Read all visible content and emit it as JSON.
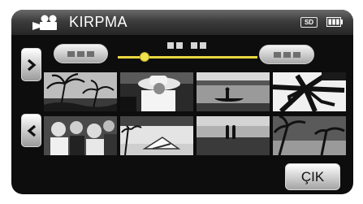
{
  "header": {
    "title": "KIRPMA",
    "mode_icon": "video-camera-icon",
    "media_badge": "SD",
    "battery_icon": "battery-full-icon"
  },
  "trim": {
    "start_marker_icon": "trim-start-marker-icon",
    "end_marker_icon": "trim-end-marker-icon",
    "timecode_icon": "timecode-blocks-icon",
    "position_fraction": 0.19,
    "accent_color": "#e8d640"
  },
  "navigation": {
    "next_icon": "chevron-right-icon",
    "prev_icon": "chevron-left-icon"
  },
  "thumbnails": [
    {
      "subject": "palm-trees"
    },
    {
      "subject": "person-in-hat"
    },
    {
      "subject": "canoe-on-water"
    },
    {
      "subject": "palm-fronds"
    },
    {
      "subject": "group-of-people"
    },
    {
      "subject": "beach-chair"
    },
    {
      "subject": "couple-at-sunset"
    },
    {
      "subject": "palm-silhouette"
    }
  ],
  "footer": {
    "exit_label": "ÇIK"
  }
}
